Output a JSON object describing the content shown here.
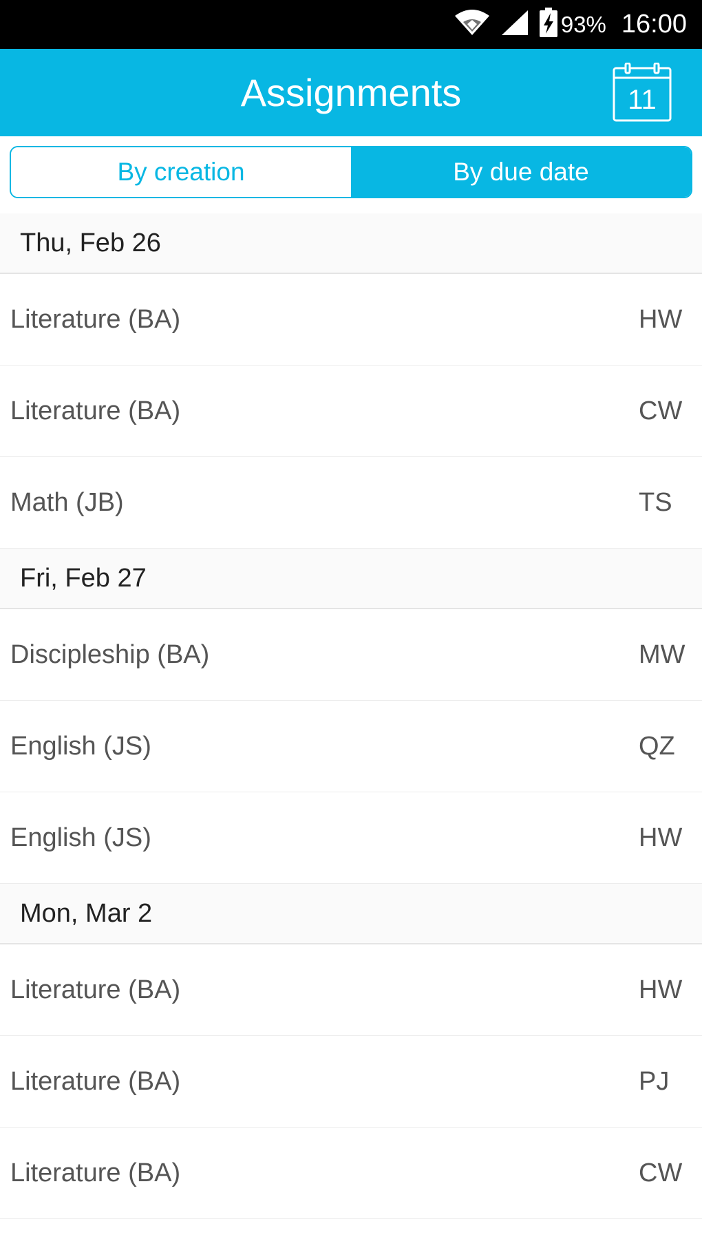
{
  "status_bar": {
    "battery_percent": "93%",
    "time": "16:00"
  },
  "app_bar": {
    "title": "Assignments",
    "calendar_day": "11"
  },
  "tabs": [
    {
      "label": "By creation",
      "active": false
    },
    {
      "label": "By due date",
      "active": true
    }
  ],
  "colors": {
    "accent": "#08b7e3",
    "status_bar": "#000000",
    "section_bg": "#fafafa",
    "row_text": "#555555"
  },
  "sections": [
    {
      "date": "Thu, Feb 26",
      "items": [
        {
          "subject": "Literature (BA)",
          "type": "HW"
        },
        {
          "subject": "Literature (BA)",
          "type": "CW"
        },
        {
          "subject": "Math (JB)",
          "type": "TS"
        }
      ]
    },
    {
      "date": "Fri, Feb 27",
      "items": [
        {
          "subject": "Discipleship (BA)",
          "type": "MW"
        },
        {
          "subject": "English (JS)",
          "type": "QZ"
        },
        {
          "subject": "English (JS)",
          "type": "HW"
        }
      ]
    },
    {
      "date": "Mon, Mar 2",
      "items": [
        {
          "subject": "Literature (BA)",
          "type": "HW"
        },
        {
          "subject": "Literature (BA)",
          "type": "PJ"
        },
        {
          "subject": "Literature (BA)",
          "type": "CW"
        }
      ]
    }
  ]
}
